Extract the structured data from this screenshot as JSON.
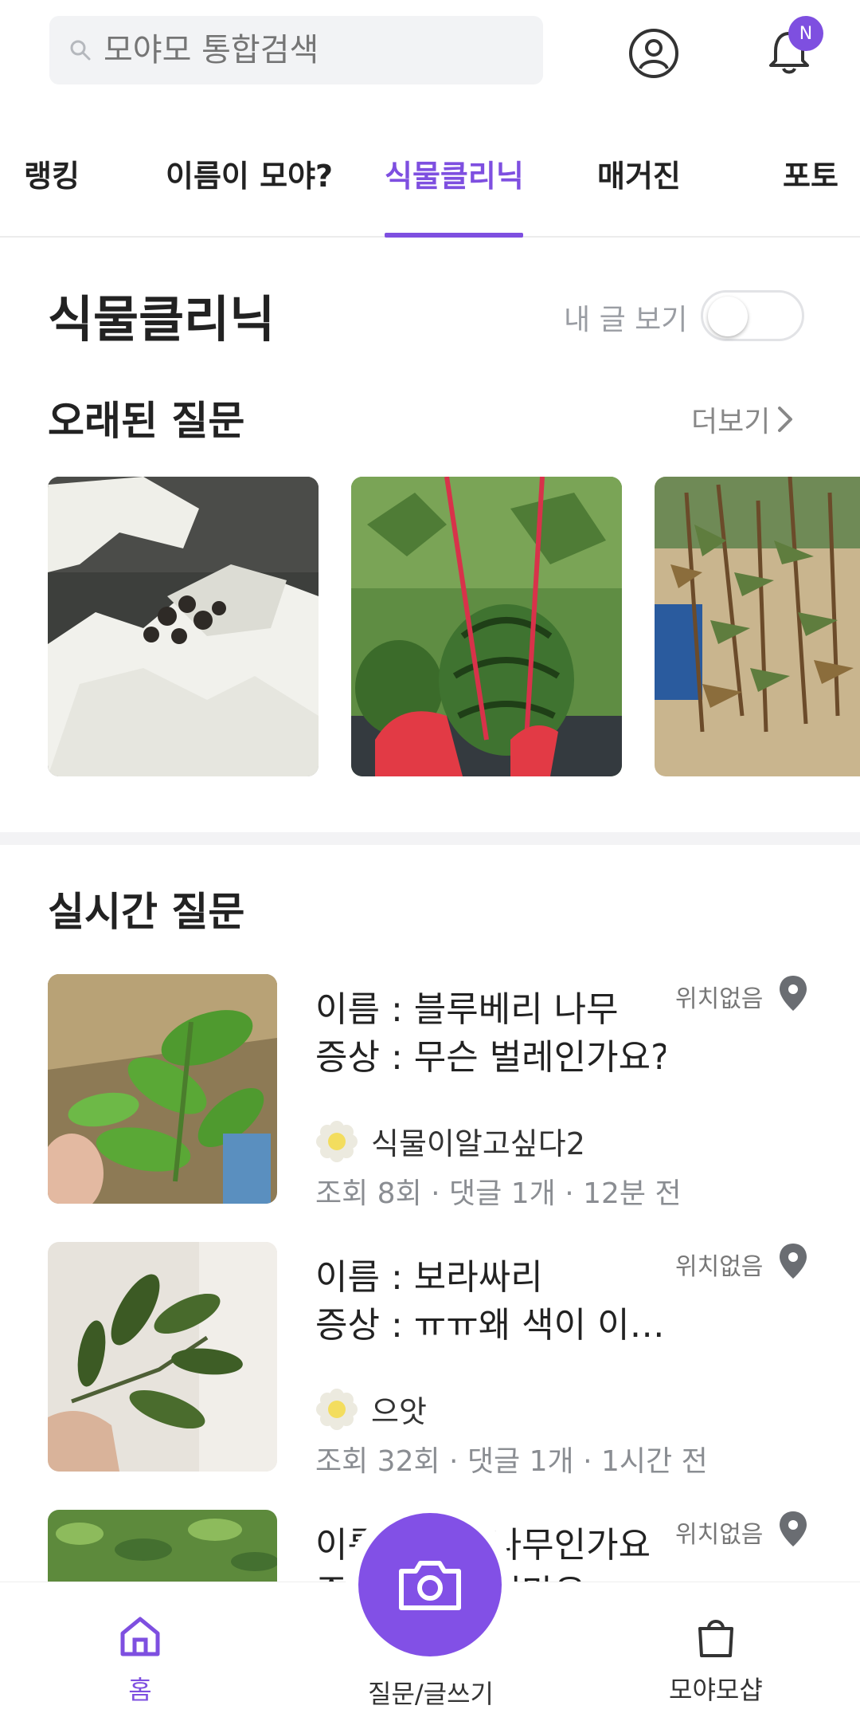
{
  "search": {
    "placeholder": "모야모 통합검색"
  },
  "notifications": {
    "badge": "N"
  },
  "tabs": [
    {
      "label": "랭킹"
    },
    {
      "label": "이름이 모야?"
    },
    {
      "label": "식물클리닉"
    },
    {
      "label": "매거진"
    },
    {
      "label": "포토"
    }
  ],
  "active_tab": "식물클리닉",
  "page": {
    "title": "식물클리닉",
    "my_posts_label": "내 글 보기",
    "my_posts_toggle": false
  },
  "old_questions": {
    "title": "오래된 질문",
    "more_label": "더보기"
  },
  "live_questions": {
    "title": "실시간 질문",
    "items": [
      {
        "line1": "이름 : 블루베리 나무",
        "line2": "증상 : 무슨 벌레인가요?",
        "location": "위치없음",
        "author": "식물이알고싶다2",
        "meta": "조회 8회 · 댓글 1개 · 12분 전"
      },
      {
        "line1": "이름 : 보라싸리",
        "line2": "증상 : ㅠㅠ왜 색이 이…",
        "location": "위치없음",
        "author": "으앗",
        "meta": "조회 32회 · 댓글 1개 · 1시간 전"
      },
      {
        "line1": "이름 : 무슨 나무인가요",
        "line2": "증상 : 잎이 지만은",
        "location": "위치없음"
      }
    ]
  },
  "bottom_nav": {
    "home": "홈",
    "write": "질문/글쓰기",
    "shop": "모야모샵"
  },
  "colors": {
    "accent": "#7e4fe0"
  }
}
